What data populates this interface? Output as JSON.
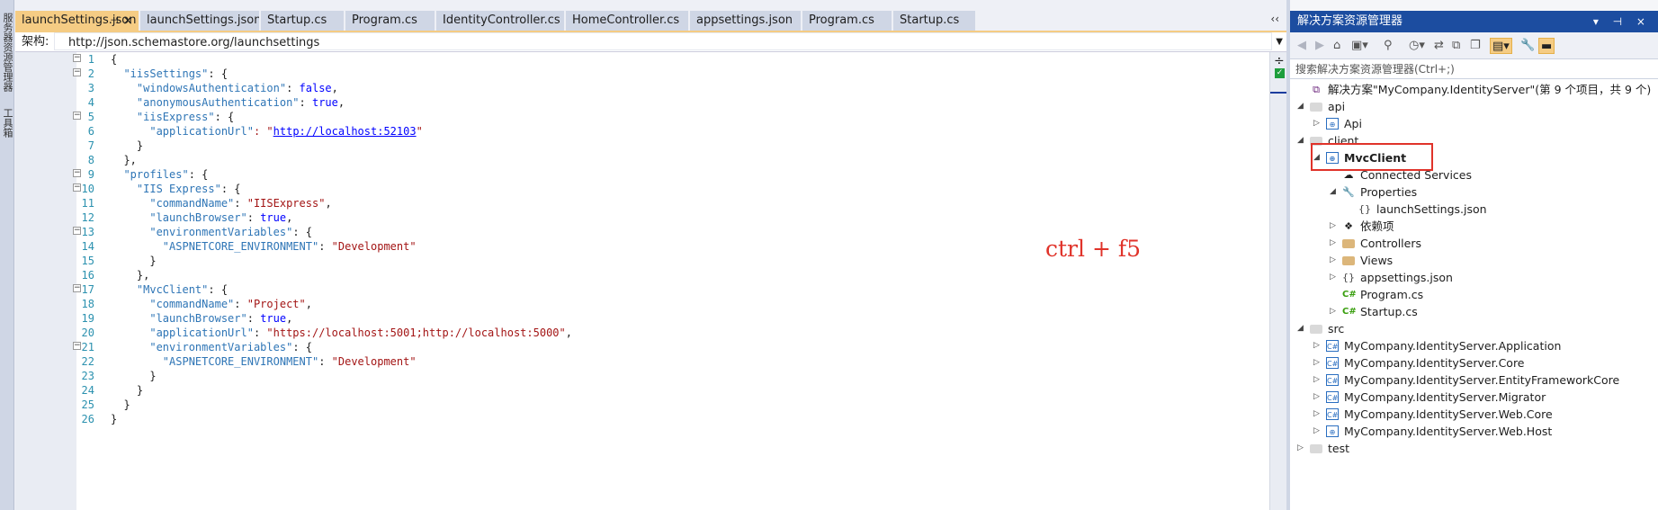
{
  "left_strip": {
    "items": [
      "服务器资源管理器",
      "工具箱"
    ]
  },
  "tabs": [
    {
      "label": "launchSettings.json",
      "active": true
    },
    {
      "label": "launchSettings.json"
    },
    {
      "label": "Startup.cs"
    },
    {
      "label": "Program.cs"
    },
    {
      "label": "IdentityController.cs"
    },
    {
      "label": "HomeController.cs"
    },
    {
      "label": "appsettings.json"
    },
    {
      "label": "Program.cs"
    },
    {
      "label": "Startup.cs"
    }
  ],
  "tab_pin": "⊣",
  "tab_close": "×",
  "tab_overflow": "‹‹",
  "schema": {
    "label": "架构:",
    "value": "http://json.schemastore.org/launchsettings"
  },
  "editor": {
    "line_numbers": [
      "1",
      "2",
      "3",
      "4",
      "5",
      "6",
      "7",
      "8",
      "9",
      "10",
      "11",
      "12",
      "13",
      "14",
      "15",
      "16",
      "17",
      "18",
      "19",
      "20",
      "21",
      "22",
      "23",
      "24",
      "25",
      "26"
    ],
    "annotation": "ctrl + f5"
  },
  "code": {
    "l1": "{",
    "l2k": "\"iisSettings\"",
    "l2p": ": {",
    "l3k": "\"windowsAuthentication\"",
    "l3p": ": ",
    "l3v": "false",
    "l3e": ",",
    "l4k": "\"anonymousAuthentication\"",
    "l4p": ": ",
    "l4v": "true",
    "l4e": ",",
    "l5k": "\"iisExpress\"",
    "l5p": ": {",
    "l6k": "\"applicationUrl\"",
    "l6p": ": \"",
    "l6v": "http://localhost:52103",
    "l6e": "\"",
    "l7": "}",
    "l8": "},",
    "l9k": "\"profiles\"",
    "l9p": ": {",
    "l10k": "\"IIS Express\"",
    "l10p": ": {",
    "l11k": "\"commandName\"",
    "l11p": ": ",
    "l11v": "\"IISExpress\"",
    "l11e": ",",
    "l12k": "\"launchBrowser\"",
    "l12p": ": ",
    "l12v": "true",
    "l12e": ",",
    "l13k": "\"environmentVariables\"",
    "l13p": ": {",
    "l14k": "\"ASPNETCORE_ENVIRONMENT\"",
    "l14p": ": ",
    "l14v": "\"Development\"",
    "l15": "}",
    "l16": "},",
    "l17k": "\"MvcClient\"",
    "l17p": ": {",
    "l18k": "\"commandName\"",
    "l18p": ": ",
    "l18v": "\"Project\"",
    "l18e": ",",
    "l19k": "\"launchBrowser\"",
    "l19p": ": ",
    "l19v": "true",
    "l19e": ",",
    "l20k": "\"applicationUrl\"",
    "l20p": ": ",
    "l20v": "\"https://localhost:5001;http://localhost:5000\"",
    "l20e": ",",
    "l21k": "\"environmentVariables\"",
    "l21p": ": {",
    "l22k": "\"ASPNETCORE_ENVIRONMENT\"",
    "l22p": ": ",
    "l22v": "\"Development\"",
    "l23": "}",
    "l24": "}",
    "l25": "}",
    "l26": "}"
  },
  "solution_explorer": {
    "title": "解决方案资源管理器",
    "title_controls": "▾ ⊣ ×",
    "search_placeholder": "搜索解决方案资源管理器(Ctrl+;)",
    "tree": [
      {
        "label": "解决方案\"MyCompany.IdentityServer\"(第 9 个项目，共 9 个)",
        "icon": "solution-icon",
        "glyph": "⧉"
      },
      {
        "label": "api",
        "icon": "solution-folder-icon",
        "arrow": "◢"
      },
      {
        "label": "Api",
        "icon": "web-project-icon",
        "arrow": "▷",
        "glyph": "⊕"
      },
      {
        "label": "client",
        "icon": "solution-folder-icon",
        "arrow": "◢"
      },
      {
        "label": "MvcClient",
        "icon": "web-project-icon",
        "arrow": "◢",
        "glyph": "⊕",
        "bold": true
      },
      {
        "label": "Connected Services",
        "icon": "connected-services-icon",
        "glyph": "☁"
      },
      {
        "label": "Properties",
        "icon": "wrench-icon",
        "arrow": "◢",
        "glyph": "🔧"
      },
      {
        "label": "launchSettings.json",
        "icon": "json-file-icon",
        "glyph": "{}"
      },
      {
        "label": "依赖项",
        "icon": "dependencies-icon",
        "arrow": "▷",
        "glyph": "❖"
      },
      {
        "label": "Controllers",
        "icon": "folder-icon",
        "arrow": "▷"
      },
      {
        "label": "Views",
        "icon": "folder-icon",
        "arrow": "▷"
      },
      {
        "label": "appsettings.json",
        "icon": "json-file-icon",
        "arrow": "▷",
        "glyph": "{}"
      },
      {
        "label": "Program.cs",
        "icon": "csharp-file-icon",
        "glyph": "C#"
      },
      {
        "label": "Startup.cs",
        "icon": "csharp-file-icon",
        "arrow": "▷",
        "glyph": "C#"
      },
      {
        "label": "src",
        "icon": "solution-folder-icon",
        "arrow": "◢"
      },
      {
        "label": "MyCompany.IdentityServer.Application",
        "icon": "csharp-project-icon",
        "arrow": "▷",
        "glyph": "C#"
      },
      {
        "label": "MyCompany.IdentityServer.Core",
        "icon": "csharp-project-icon",
        "arrow": "▷",
        "glyph": "C#"
      },
      {
        "label": "MyCompany.IdentityServer.EntityFrameworkCore",
        "icon": "csharp-project-icon",
        "arrow": "▷",
        "glyph": "C#"
      },
      {
        "label": "MyCompany.IdentityServer.Migrator",
        "icon": "csharp-project-icon",
        "arrow": "▷",
        "glyph": "C#"
      },
      {
        "label": "MyCompany.IdentityServer.Web.Core",
        "icon": "csharp-project-icon",
        "arrow": "▷",
        "glyph": "C#"
      },
      {
        "label": "MyCompany.IdentityServer.Web.Host",
        "icon": "web-project-icon",
        "arrow": "▷",
        "glyph": "⊕"
      },
      {
        "label": "test",
        "icon": "solution-folder-icon",
        "arrow": "▷"
      }
    ]
  },
  "colors": {
    "active_tab": "#f5cc84",
    "title_bar": "#1c4da0",
    "annotation": "#e0332a"
  }
}
